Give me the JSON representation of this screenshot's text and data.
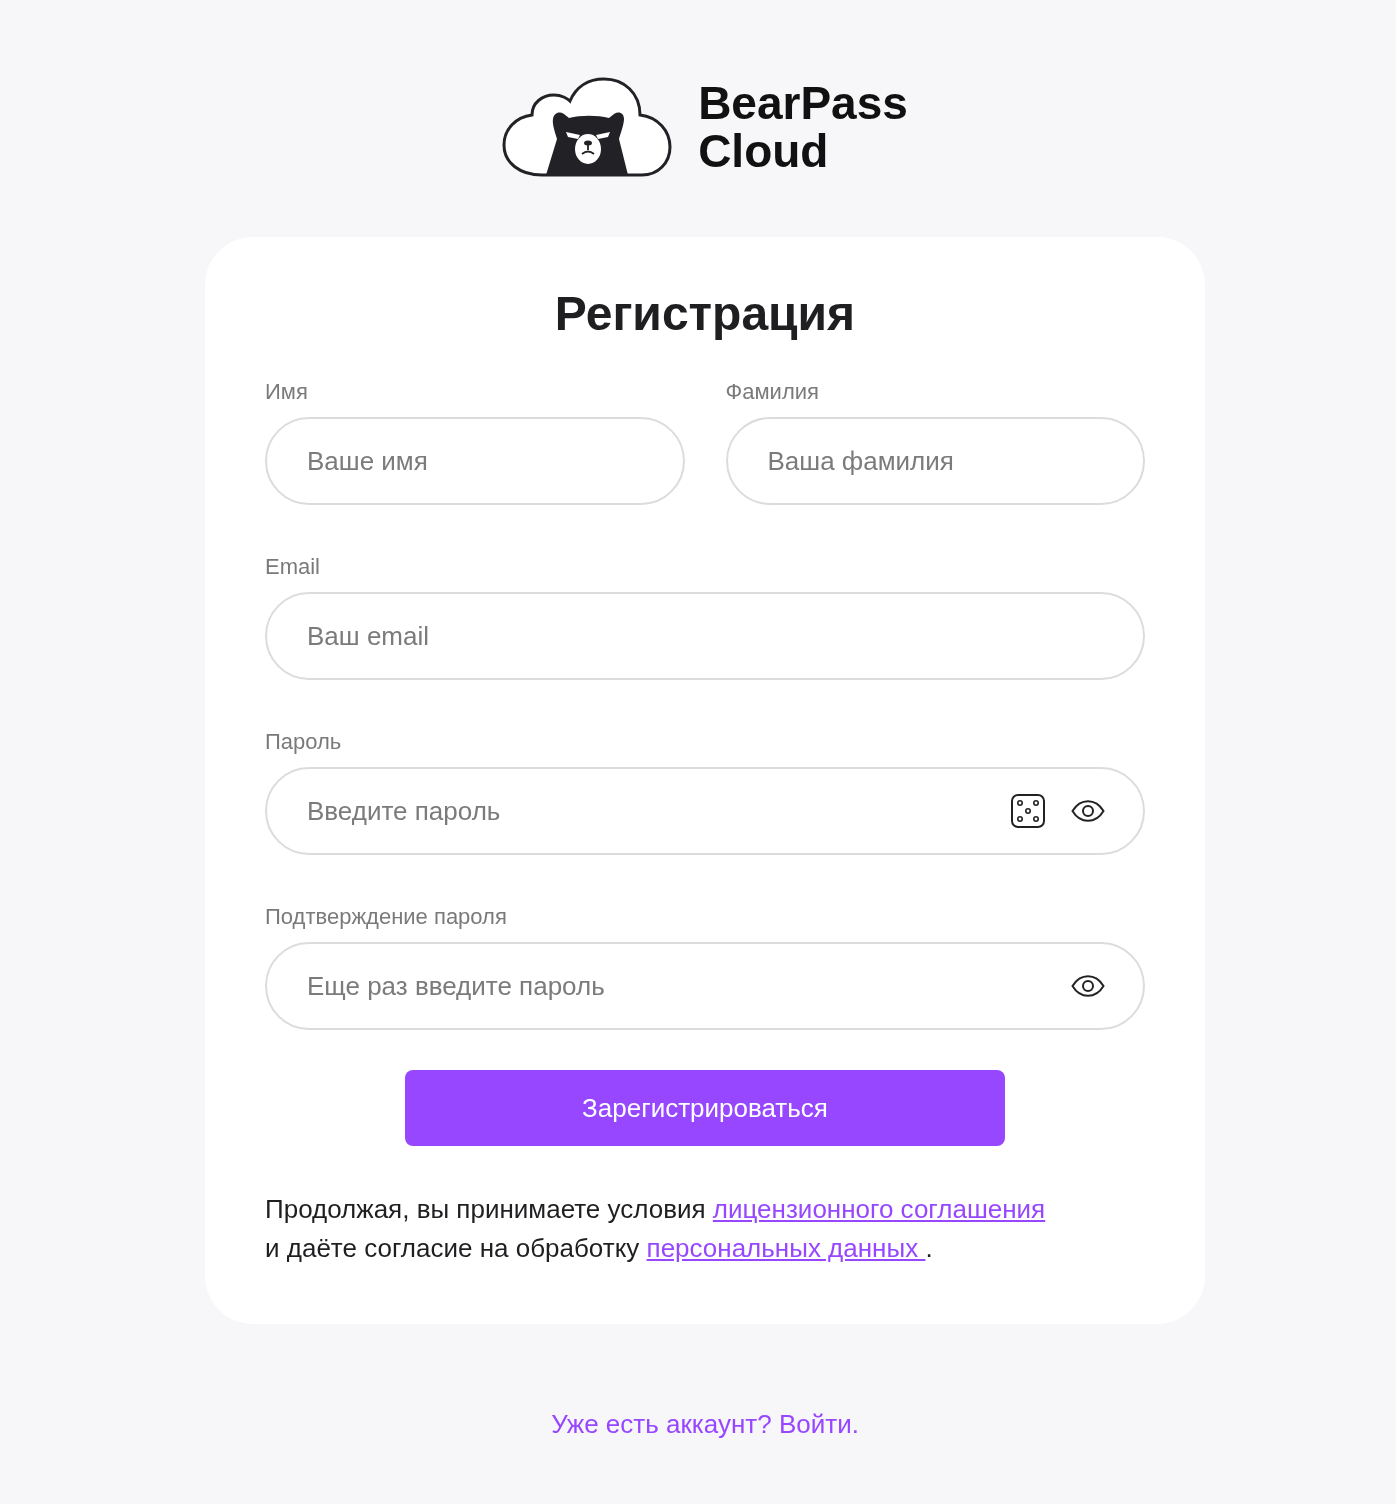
{
  "logo": {
    "name_line_1": "BearPass",
    "name_line_2": "Cloud"
  },
  "form": {
    "title": "Регистрация",
    "rows": [
      [
        {
          "kind": "text",
          "label": "Имя",
          "placeholder": "Ваше имя"
        },
        {
          "kind": "text",
          "label": "Фамилия",
          "placeholder": "Ваша фамилия"
        }
      ],
      [
        {
          "kind": "text",
          "label": "Email",
          "placeholder": "Ваш email"
        }
      ],
      [
        {
          "kind": "password",
          "label": "Пароль",
          "placeholder": "Введите пароль",
          "generator": true
        }
      ],
      [
        {
          "kind": "password",
          "label": "Подтверждение пароля",
          "placeholder": "Еще раз введите пароль",
          "generator": false
        }
      ]
    ],
    "submit_button": "Зарегистрироваться",
    "consent": [
      {
        "kind": "text",
        "text": "Продолжая, вы принимаете условия "
      },
      {
        "kind": "link",
        "text": "лицензионного соглашения"
      },
      {
        "kind": "text",
        "text": " и даёте согласие на обработку "
      },
      {
        "kind": "link",
        "text": "персональных данных "
      },
      {
        "kind": "text",
        "text": "."
      }
    ]
  },
  "login_link": "Уже есть аккаунт? Войти."
}
